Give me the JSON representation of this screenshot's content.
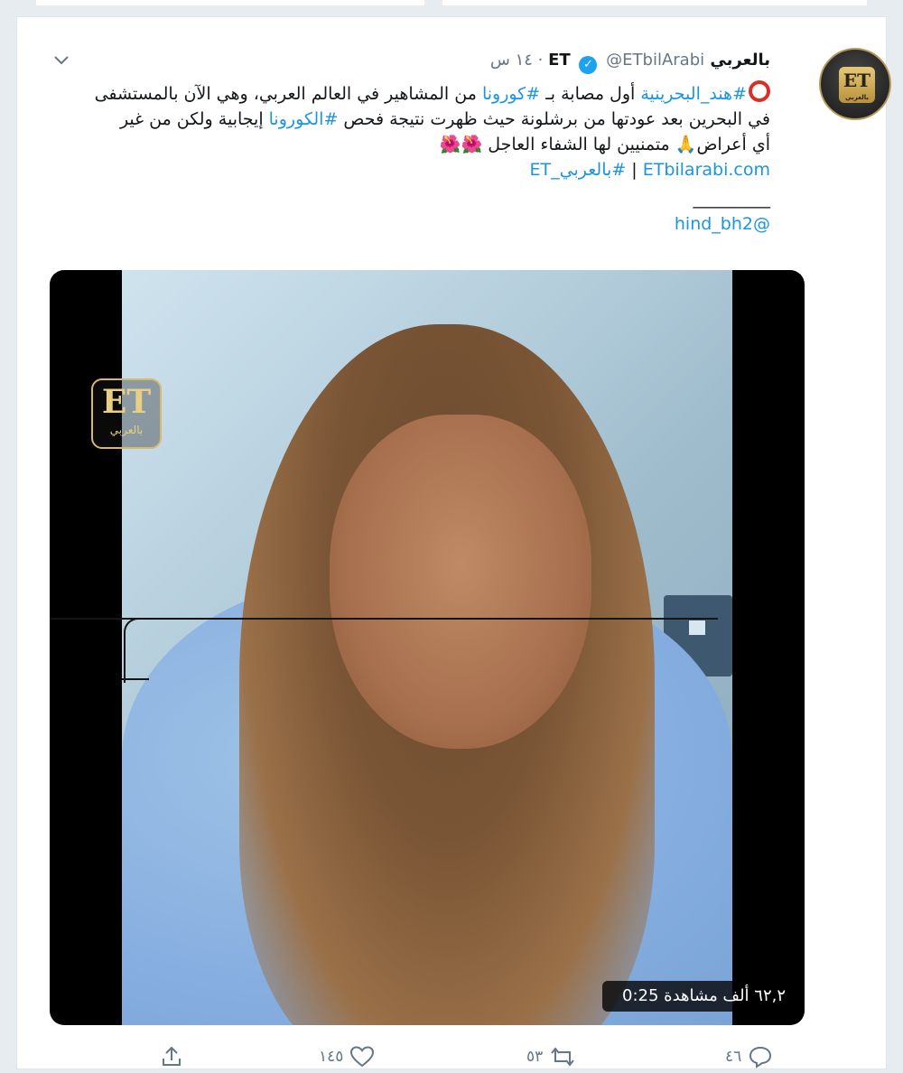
{
  "tweet": {
    "author": {
      "display_name": "بالعربي ET",
      "verified_icon": "verified-badge-icon",
      "handle": "@ETbilArabi",
      "separator": "·",
      "time": "١٤ س"
    },
    "avatar": {
      "logo": "ET",
      "logo_sub": "بالعربي"
    },
    "text": {
      "line1_tag1": "#هند_البحرينية",
      "line1_mid": " أول مصابة بـ ",
      "line1_tag2": "#كورونا",
      "line1_end": " من المشاهير في العالم العربي، وهي الآن بالمستشفى",
      "line2_start": "في البحرين بعد عودتها من برشلونة حيث ظهرت نتيجة فحص ",
      "line2_tag": "#الكورونا",
      "line2_end": " إيجابية ولكن من غير",
      "line3_start": "أي أعراض",
      "line3_emoji_pray": "🙏",
      "line3_end": " متمنيين لها الشفاء العاجل ",
      "line3_emoji_flowers": "🌺🌺",
      "line4_link": "ETbilarabi.com",
      "line4_sep": " | ",
      "line4_tag": "#بالعربي_ET",
      "line5_underline": "_________",
      "line6_mention": "@hind_bh2"
    },
    "video": {
      "overlay_logo": "ET",
      "overlay_logo_sub": "بالعربي",
      "views": "٦٢,٢ ألف مشاهدة",
      "duration": "0:25"
    },
    "actions": {
      "reply_count": "٤٦",
      "retweet_count": "٥٣",
      "like_count": "١٤٥"
    }
  }
}
